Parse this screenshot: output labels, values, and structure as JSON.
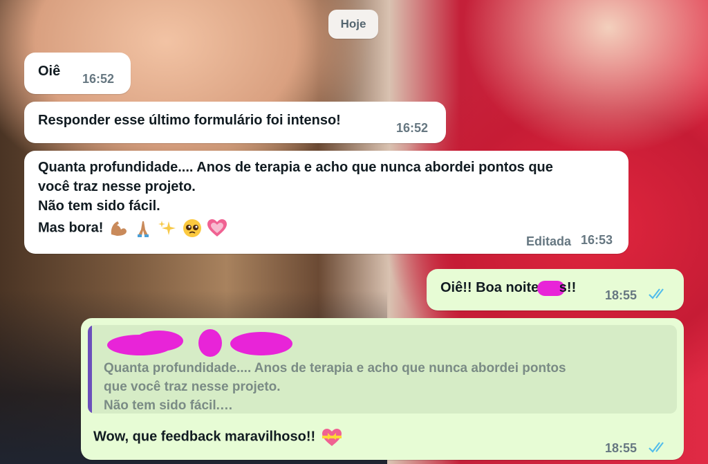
{
  "date_divider": "Hoje",
  "messages": [
    {
      "text": "Oiê",
      "time": "16:52"
    },
    {
      "text": "Responder esse último formulário foi intenso!",
      "time": "16:52"
    },
    {
      "lines": [
        "Quanta profundidade.... Anos de terapia e acho que nunca abordei pontos que",
        "você traz nesse projeto.",
        "Não tem sido fácil.",
        "Mas bora!"
      ],
      "emojis": [
        "flexed-biceps",
        "folded-hands",
        "sparkles",
        "pleading-face",
        "growing-heart"
      ],
      "edited": "Editada",
      "time": "16:53"
    },
    {
      "text": "Oiê!! Boa noite,",
      "suffix": "s!!",
      "time": "18:55"
    },
    {
      "quote_lines": [
        "Quanta profundidade.... Anos de terapia e acho que nunca abordei pontos",
        "que você traz nesse projeto.",
        "Não tem sido fácil.…"
      ],
      "text": "Wow, que feedback maravilhoso!!",
      "emoji": "heart-with-ribbon",
      "time": "18:55"
    }
  ],
  "colors": {
    "incoming": "#ffffff",
    "outgoing": "#e7fcd5",
    "read_ticks": "#53bdeb",
    "quote_bar": "#6b4fbb"
  }
}
